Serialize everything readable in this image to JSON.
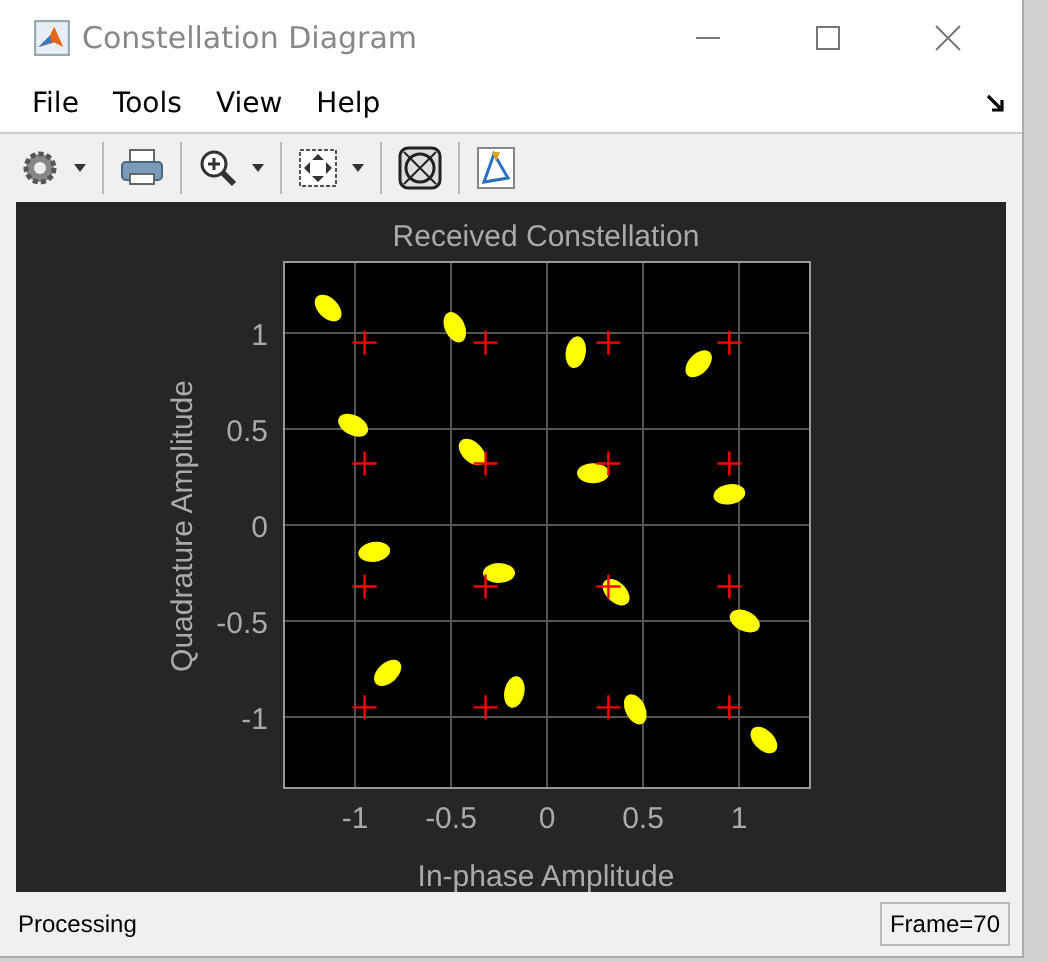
{
  "window": {
    "title": "Constellation Diagram"
  },
  "menu": [
    {
      "label": "File"
    },
    {
      "label": "Tools"
    },
    {
      "label": "View"
    },
    {
      "label": "Help"
    }
  ],
  "toolbar": [
    {
      "kind": "settings",
      "dropdown": true
    },
    {
      "kind": "print",
      "dropdown": false
    },
    {
      "kind": "zoom",
      "dropdown": true
    },
    {
      "kind": "fit",
      "dropdown": true
    },
    {
      "kind": "constellation",
      "dropdown": false
    },
    {
      "kind": "edit",
      "dropdown": false
    }
  ],
  "chart": {
    "chart_data": {
      "type": "scatter",
      "title": "Received Constellation",
      "xlabel": "In-phase Amplitude",
      "ylabel": "Quadrature Amplitude",
      "xlim": [
        -1.37,
        1.37
      ],
      "ylim": [
        -1.37,
        1.37
      ],
      "grid": true,
      "xticks": [
        -1,
        -0.5,
        0,
        0.5,
        1
      ],
      "yticks": [
        -1,
        -0.5,
        0,
        0.5,
        1
      ],
      "series": [
        {
          "marker": "dot",
          "color": "#ffff00",
          "x": [
            -1.14,
            -0.48,
            0.15,
            0.79,
            -1.01,
            -0.39,
            0.24,
            0.95,
            -0.9,
            -0.25,
            0.36,
            1.03,
            -0.83,
            -0.17,
            0.46,
            1.13
          ],
          "values": [
            1.13,
            1.03,
            0.9,
            0.84,
            0.52,
            0.38,
            0.27,
            0.16,
            -0.14,
            -0.25,
            -0.35,
            -0.5,
            -0.77,
            -0.87,
            -0.96,
            -1.12
          ]
        },
        {
          "marker": "plus",
          "color": "#ff0000",
          "x": [
            -0.95,
            -0.32,
            0.32,
            0.95,
            -0.95,
            -0.32,
            0.32,
            0.95,
            -0.95,
            -0.32,
            0.32,
            0.95,
            -0.95,
            -0.32,
            0.32,
            0.95
          ],
          "values": [
            0.95,
            0.95,
            0.95,
            0.95,
            0.32,
            0.32,
            0.32,
            0.32,
            -0.32,
            -0.32,
            -0.32,
            -0.32,
            -0.95,
            -0.95,
            -0.95,
            -0.95
          ]
        }
      ]
    }
  },
  "status_bar": {
    "message": "Processing",
    "frame": "Frame=70"
  }
}
